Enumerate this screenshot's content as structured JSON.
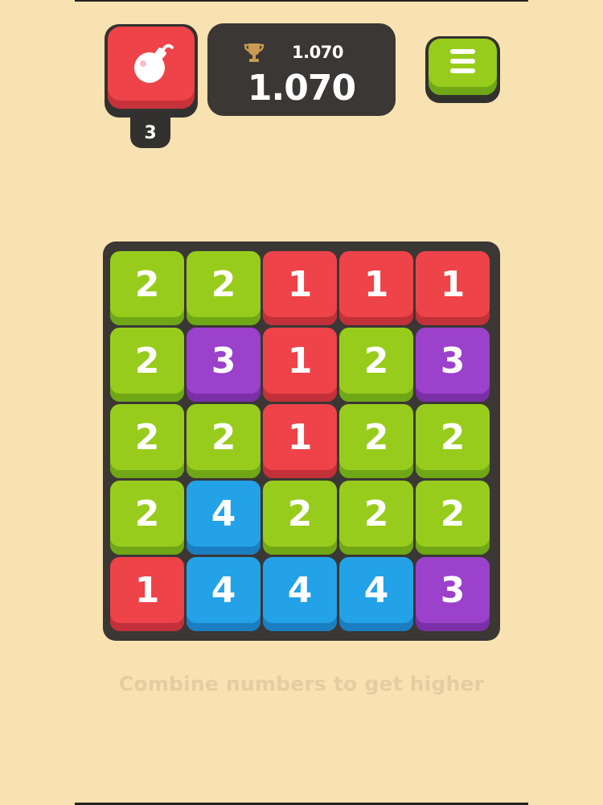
{
  "bomb": {
    "count": "3",
    "icon": "bomb-icon",
    "color": "#ee4348"
  },
  "score": {
    "best": "1.070",
    "current": "1.070",
    "trophy_icon": "trophy-icon"
  },
  "menu": {
    "icon": "hamburger-icon",
    "color": "#98cc1c"
  },
  "board": {
    "rows": [
      [
        "2",
        "2",
        "1",
        "1",
        "1"
      ],
      [
        "2",
        "3",
        "1",
        "2",
        "3"
      ],
      [
        "2",
        "2",
        "1",
        "2",
        "2"
      ],
      [
        "2",
        "4",
        "2",
        "2",
        "2"
      ],
      [
        "1",
        "4",
        "4",
        "4",
        "3"
      ]
    ]
  },
  "tile_colors": {
    "1": {
      "face": "#ee4348",
      "shade": "#c23039"
    },
    "2": {
      "face": "#98cc1c",
      "shade": "#6fa716"
    },
    "3": {
      "face": "#9b41cc",
      "shade": "#7a2fa6"
    },
    "4": {
      "face": "#23a2e8",
      "shade": "#1a7ec1"
    }
  },
  "hint": "Combine numbers to get higher"
}
